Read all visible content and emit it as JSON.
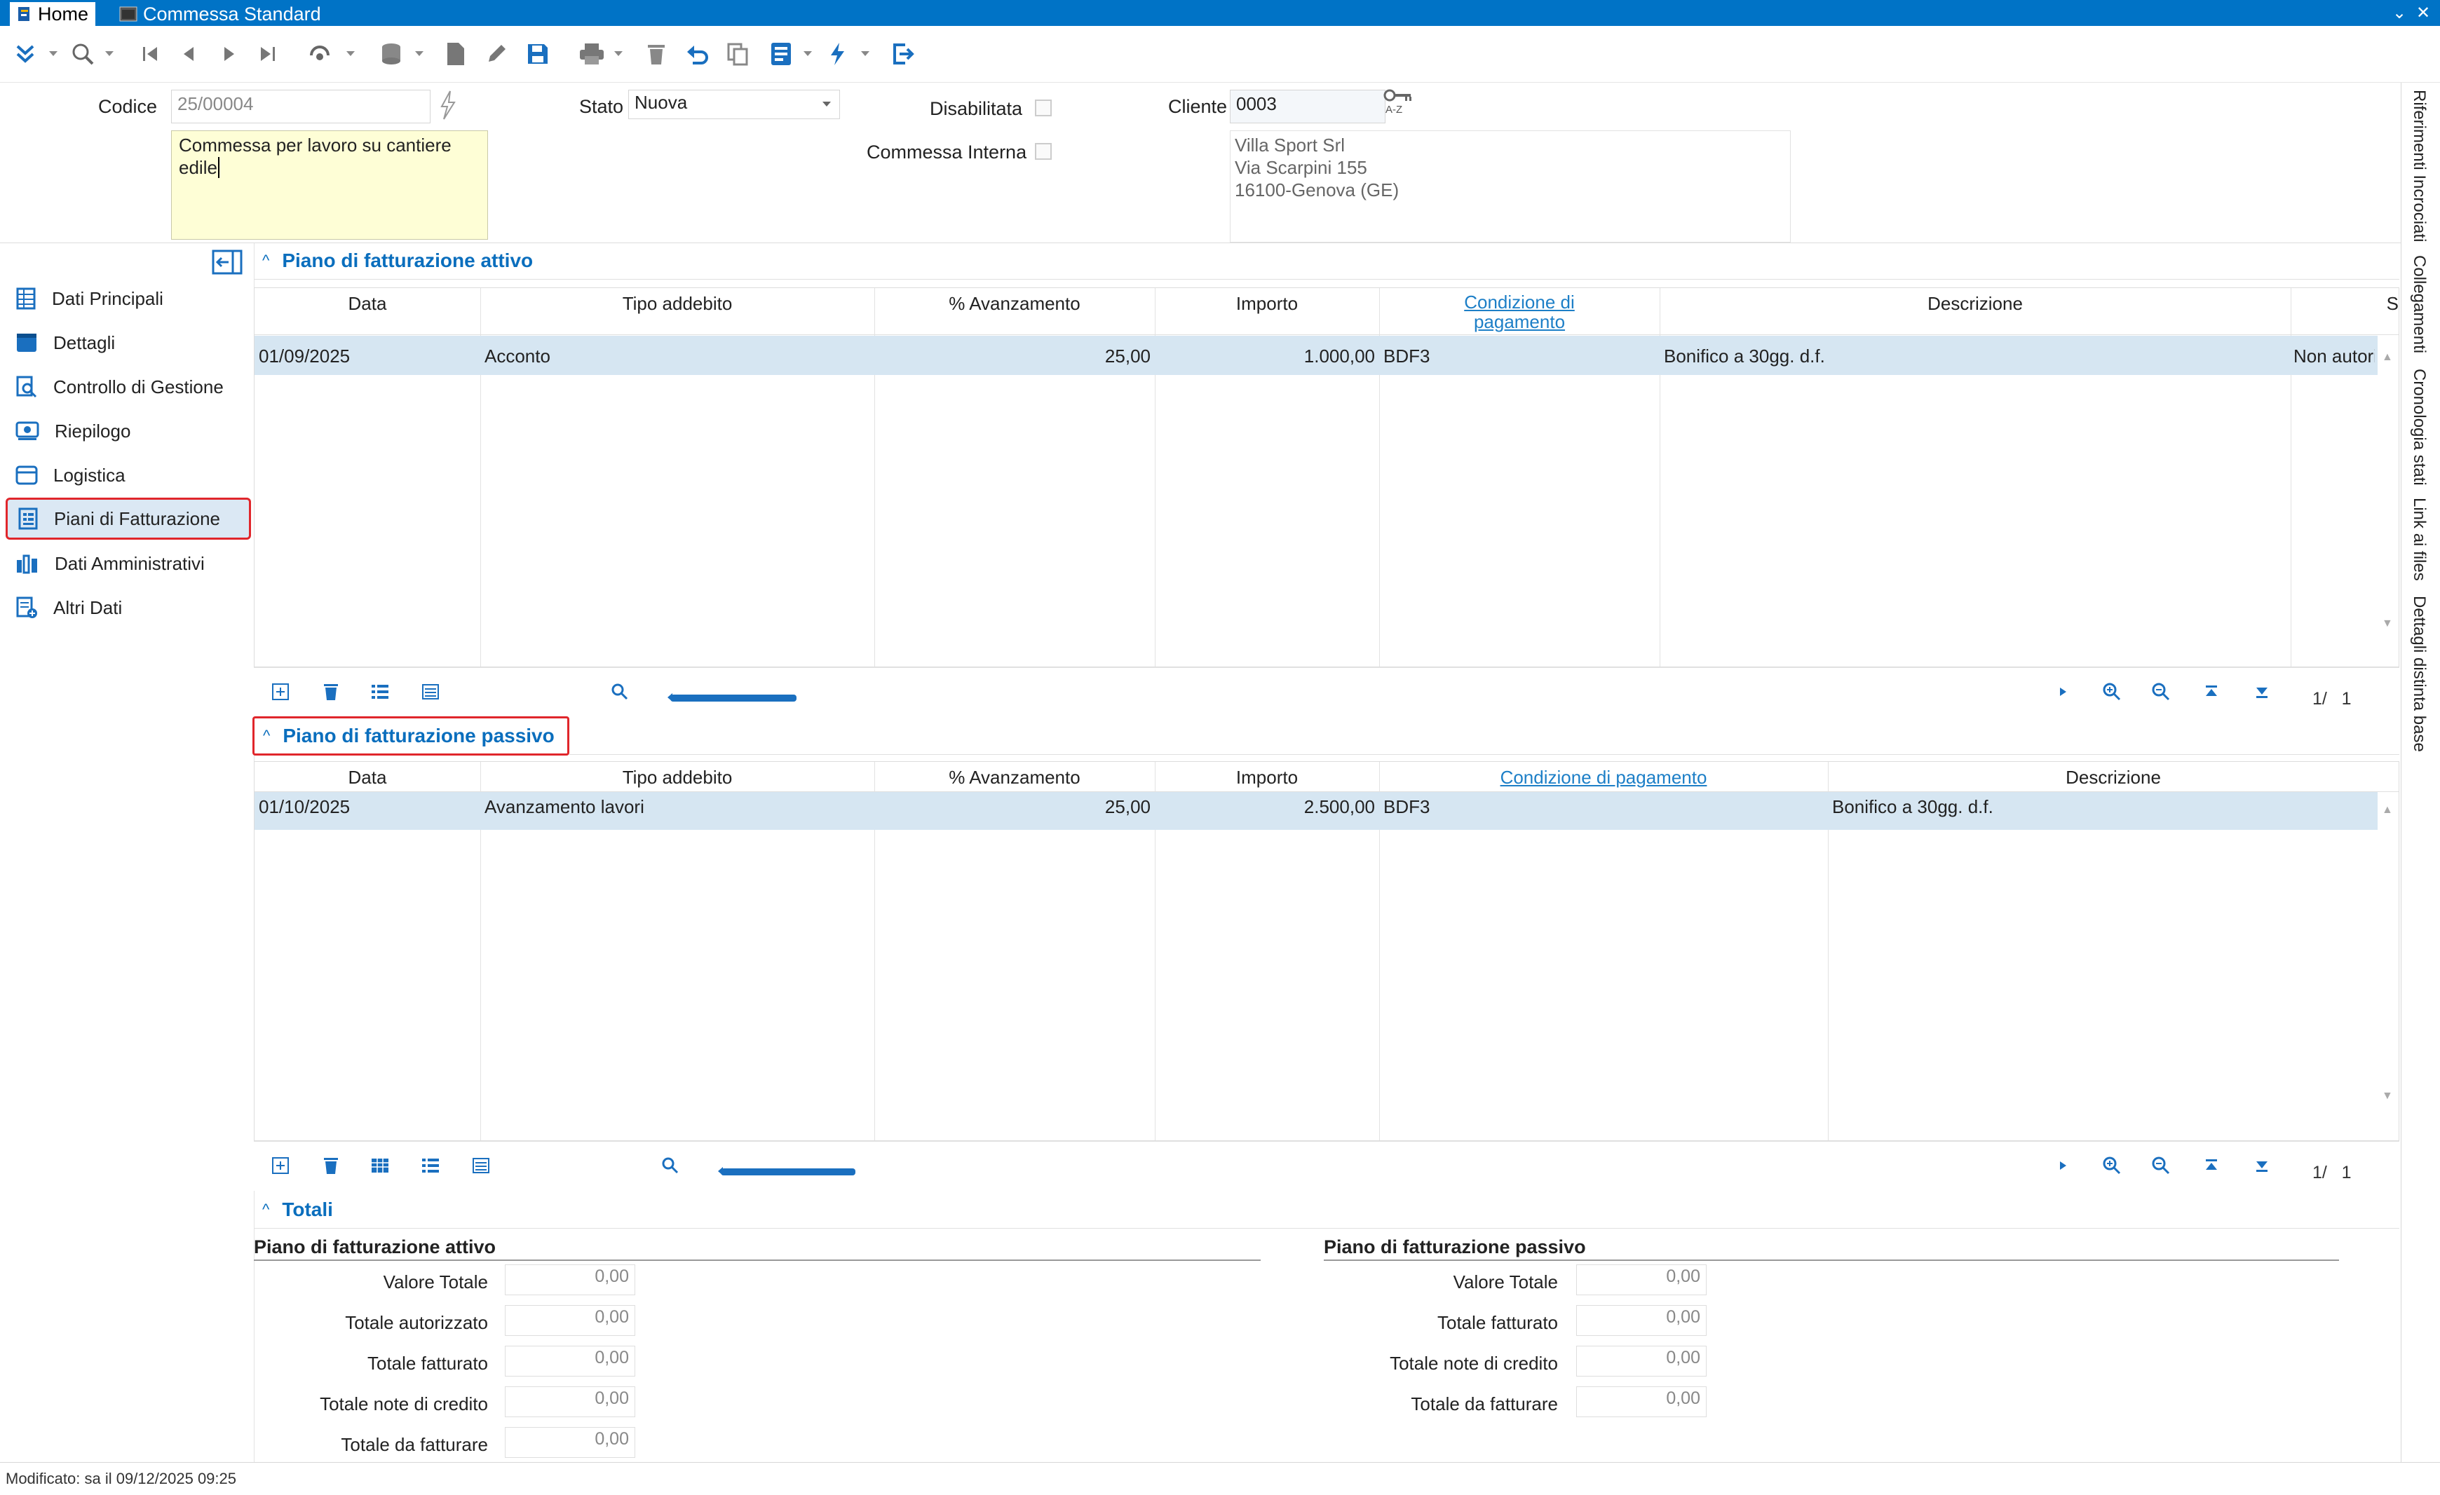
{
  "window": {
    "tabs": [
      {
        "label": "Home"
      },
      {
        "label": "Commessa Standard"
      }
    ]
  },
  "header": {
    "codice_label": "Codice",
    "codice_value": "25/00004",
    "stato_label": "Stato",
    "stato_value": "Nuova",
    "disabilitata_label": "Disabilitata",
    "commessa_interna_label": "Commessa Interna",
    "cliente_label": "Cliente",
    "cliente_value": "0003",
    "cliente_sort_hint": "A-Z",
    "descrizione_line1": "Commessa per lavoro su cantiere",
    "descrizione_line2": "edile",
    "cliente_indirizzo": [
      "Villa Sport Srl",
      "Via Scarpini 155",
      "16100-Genova (GE)"
    ]
  },
  "sidebar": {
    "items": [
      {
        "label": "Dati Principali",
        "icon": "grid-icon"
      },
      {
        "label": "Dettagli",
        "icon": "calendar-icon"
      },
      {
        "label": "Controllo di Gestione",
        "icon": "search-doc-icon"
      },
      {
        "label": "Riepilogo",
        "icon": "summary-icon"
      },
      {
        "label": "Logistica",
        "icon": "logistics-icon"
      },
      {
        "label": "Piani di Fatturazione",
        "icon": "invoice-plan-icon",
        "selected": true
      },
      {
        "label": "Dati Amministrativi",
        "icon": "chart-icon"
      },
      {
        "label": "Altri Dati",
        "icon": "add-doc-icon"
      }
    ]
  },
  "attivo": {
    "title": "Piano di fatturazione attivo",
    "columns": [
      "Data",
      "Tipo addebito",
      "% Avanzamento",
      "Importo",
      "Condizione di pagamento",
      "Descrizione",
      "S"
    ],
    "rows": [
      {
        "data": "01/09/2025",
        "tipo": "Acconto",
        "avanzamento": "25,00",
        "importo": "1.000,00",
        "condizione": "BDF3",
        "descrizione": "Bonifico a 30gg. d.f.",
        "stato": "Non autori"
      }
    ],
    "pagination": "1/   1"
  },
  "passivo": {
    "title": "Piano di fatturazione passivo",
    "columns": [
      "Data",
      "Tipo addebito",
      "% Avanzamento",
      "Importo",
      "Condizione di pagamento",
      "Descrizione"
    ],
    "rows": [
      {
        "data": "01/10/2025",
        "tipo": "Avanzamento lavori",
        "avanzamento": "25,00",
        "importo": "2.500,00",
        "condizione": "BDF3",
        "descrizione": "Bonifico a 30gg. d.f."
      }
    ],
    "pagination": "1/   1"
  },
  "totali": {
    "title": "Totali",
    "attivo": {
      "title": "Piano di fatturazione attivo",
      "rows": [
        {
          "label": "Valore Totale",
          "value": "0,00"
        },
        {
          "label": "Totale autorizzato",
          "value": "0,00"
        },
        {
          "label": "Totale fatturato",
          "value": "0,00"
        },
        {
          "label": "Totale note di credito",
          "value": "0,00"
        },
        {
          "label": "Totale da fatturare",
          "value": "0,00"
        }
      ]
    },
    "passivo": {
      "title": "Piano di fatturazione passivo",
      "rows": [
        {
          "label": "Valore Totale",
          "value": "0,00"
        },
        {
          "label": "Totale fatturato",
          "value": "0,00"
        },
        {
          "label": "Totale note di credito",
          "value": "0,00"
        },
        {
          "label": "Totale da fatturare",
          "value": "0,00"
        }
      ]
    }
  },
  "side_tabs": [
    "Riferimenti Incrociati",
    "Collegamenti",
    "Cronologia stati",
    "Link ai files",
    "Dettagli distinta base"
  ],
  "status": "Modificato: sa il 09/12/2025 09:25",
  "colors": {
    "titlebar": "#0073c6",
    "accent": "#0a6ebd",
    "selected_row": "#d6e6f2",
    "highlight_border": "#e0262b",
    "note_bg": "#fefed6"
  }
}
